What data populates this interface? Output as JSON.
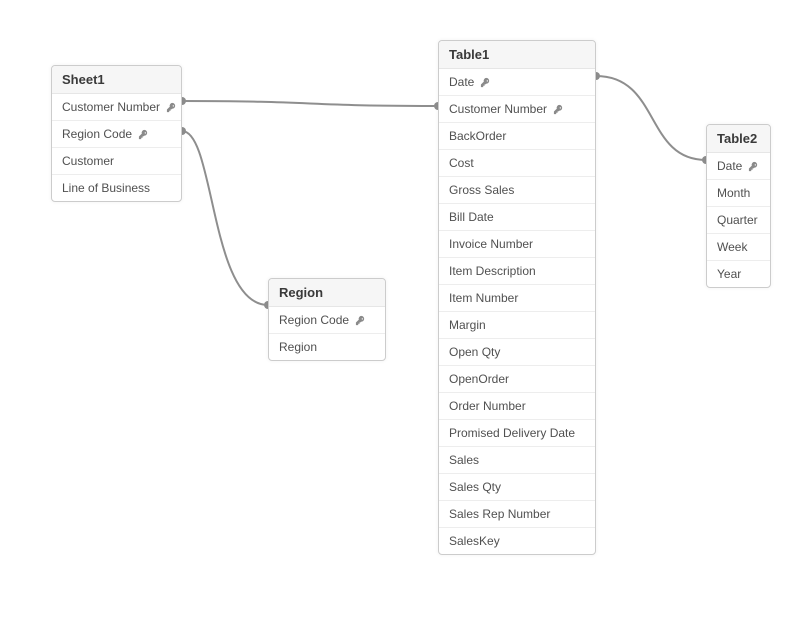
{
  "tables": [
    {
      "name": "Sheet1",
      "fields": [
        {
          "label": "Customer Number",
          "key": true
        },
        {
          "label": "Region Code",
          "key": true
        },
        {
          "label": "Customer",
          "key": false
        },
        {
          "label": "Line of Business",
          "key": false
        }
      ]
    },
    {
      "name": "Region",
      "fields": [
        {
          "label": "Region Code",
          "key": true
        },
        {
          "label": "Region",
          "key": false
        }
      ]
    },
    {
      "name": "Table1",
      "fields": [
        {
          "label": "Date",
          "key": true
        },
        {
          "label": "Customer Number",
          "key": true
        },
        {
          "label": "BackOrder",
          "key": false
        },
        {
          "label": "Cost",
          "key": false
        },
        {
          "label": "Gross Sales",
          "key": false
        },
        {
          "label": "Bill Date",
          "key": false
        },
        {
          "label": "Invoice Number",
          "key": false
        },
        {
          "label": "Item Description",
          "key": false
        },
        {
          "label": "Item Number",
          "key": false
        },
        {
          "label": "Margin",
          "key": false
        },
        {
          "label": "Open Qty",
          "key": false
        },
        {
          "label": "OpenOrder",
          "key": false
        },
        {
          "label": "Order Number",
          "key": false
        },
        {
          "label": "Promised Delivery Date",
          "key": false
        },
        {
          "label": "Sales",
          "key": false
        },
        {
          "label": "Sales Qty",
          "key": false
        },
        {
          "label": "Sales Rep Number",
          "key": false
        },
        {
          "label": "SalesKey",
          "key": false
        }
      ]
    },
    {
      "name": "Table2",
      "fields": [
        {
          "label": "Date",
          "key": true
        },
        {
          "label": "Month",
          "key": false
        },
        {
          "label": "Quarter",
          "key": false
        },
        {
          "label": "Week",
          "key": false
        },
        {
          "label": "Year",
          "key": false
        }
      ]
    }
  ],
  "relationships": [
    {
      "from": "Sheet1.Customer Number",
      "to": "Table1.Customer Number"
    },
    {
      "from": "Sheet1.Region Code",
      "to": "Region.Region Code"
    },
    {
      "from": "Table1.Date",
      "to": "Table2.Date"
    }
  ]
}
